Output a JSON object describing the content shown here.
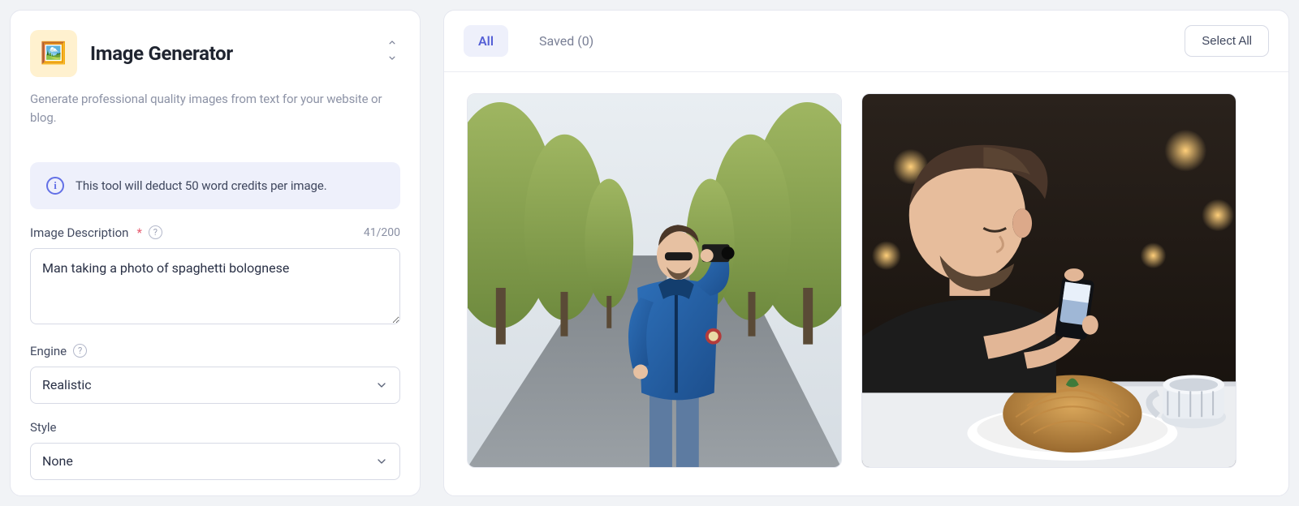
{
  "tool": {
    "title": "Image Generator",
    "subtitle": "Generate professional quality images from text for your website or blog.",
    "icon_glyph": "🖼️"
  },
  "banner": {
    "text": "This tool will deduct 50 word credits per image."
  },
  "fields": {
    "description": {
      "label": "Image Description",
      "value": "Man taking a photo of spaghetti bolognese",
      "counter": "41/200"
    },
    "engine": {
      "label": "Engine",
      "value": "Realistic"
    },
    "style": {
      "label": "Style",
      "value": "None"
    }
  },
  "tabs": {
    "all": "All",
    "saved_label": "Saved (0)"
  },
  "select_all_label": "Select All",
  "images": {
    "count": 2,
    "alt1": "Man in blue jacket taking a photo on a tree-lined road",
    "alt2": "Man photographing a plate of spaghetti with a phone"
  }
}
